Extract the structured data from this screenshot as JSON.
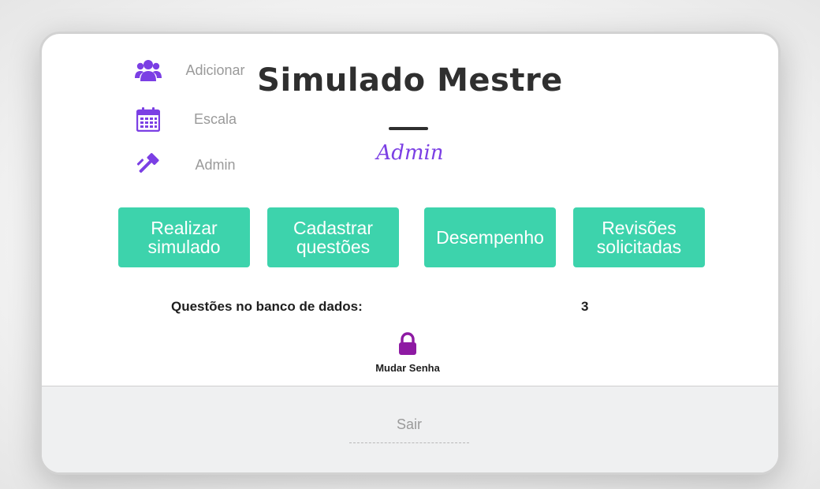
{
  "app": {
    "title": "Simulado Mestre",
    "role": "Admin"
  },
  "side_nav": {
    "items": [
      {
        "label": "Adicionar",
        "icon": "users-icon"
      },
      {
        "label": "Escala",
        "icon": "calendar-icon"
      },
      {
        "label": "Admin",
        "icon": "gavel-icon"
      }
    ]
  },
  "actions": [
    {
      "label": "Realizar\nsimulado"
    },
    {
      "label": "Cadastrar\nquestões"
    },
    {
      "label": "Desempenho"
    },
    {
      "label": "Revisões\nsolicitadas"
    }
  ],
  "stats": {
    "label": "Questões no banco de dados:",
    "value": "3"
  },
  "password": {
    "label": "Mudar Senha",
    "icon": "lock-icon"
  },
  "footer": {
    "logout_label": "Sair"
  },
  "colors": {
    "accent_purple": "#7b3fe4",
    "button_green": "#3dd3ac",
    "lock_purple": "#8e1aa3",
    "title_dark": "#2f2f2f"
  }
}
